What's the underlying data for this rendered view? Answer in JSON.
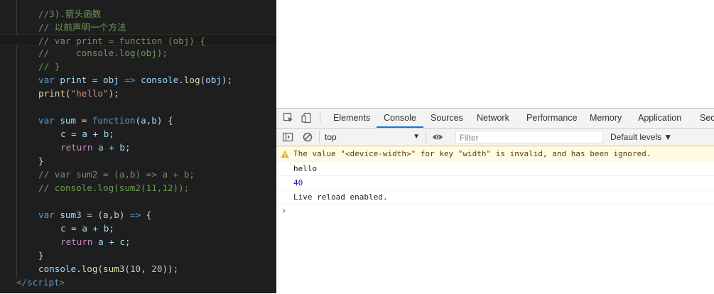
{
  "editor": {
    "lines": [
      {
        "indent": 1,
        "tokens": [
          [
            "cmt",
            "//3).箭头函数"
          ]
        ]
      },
      {
        "indent": 1,
        "tokens": [
          [
            "cmt",
            "// 以前声明一个方法"
          ]
        ]
      },
      {
        "indent": 1,
        "sel": true,
        "tokens": [
          [
            "cmt",
            "// var print = function (obj) {"
          ]
        ]
      },
      {
        "indent": 1,
        "tokens": [
          [
            "cmt",
            "//     console.log(obj);"
          ]
        ]
      },
      {
        "indent": 1,
        "tokens": [
          [
            "cmt",
            "// }"
          ]
        ]
      },
      {
        "indent": 1,
        "tokens": [
          [
            "kw",
            "var "
          ],
          [
            "var",
            "print"
          ],
          [
            "pun",
            " = "
          ],
          [
            "var",
            "obj"
          ],
          [
            "kw",
            " => "
          ],
          [
            "var",
            "console"
          ],
          [
            "pun",
            "."
          ],
          [
            "fn",
            "log"
          ],
          [
            "pun",
            "("
          ],
          [
            "var",
            "obj"
          ],
          [
            "pun",
            ");"
          ]
        ]
      },
      {
        "indent": 1,
        "tokens": [
          [
            "fn",
            "print"
          ],
          [
            "pun",
            "("
          ],
          [
            "str",
            "\"hello\""
          ],
          [
            "pun",
            ");"
          ]
        ]
      },
      {
        "indent": 1,
        "tokens": []
      },
      {
        "indent": 1,
        "tokens": [
          [
            "kw",
            "var "
          ],
          [
            "var",
            "sum"
          ],
          [
            "pun",
            " = "
          ],
          [
            "kw",
            "function"
          ],
          [
            "pun",
            "("
          ],
          [
            "var",
            "a"
          ],
          [
            "pun",
            ","
          ],
          [
            "var",
            "b"
          ],
          [
            "pun",
            ") {"
          ]
        ]
      },
      {
        "indent": 2,
        "tokens": [
          [
            "var",
            "c"
          ],
          [
            "pun",
            " = "
          ],
          [
            "var",
            "a"
          ],
          [
            "pun",
            " + "
          ],
          [
            "var",
            "b"
          ],
          [
            "pun",
            ";"
          ]
        ]
      },
      {
        "indent": 2,
        "tokens": [
          [
            "ctl",
            "return "
          ],
          [
            "var",
            "a"
          ],
          [
            "pun",
            " + "
          ],
          [
            "var",
            "b"
          ],
          [
            "pun",
            ";"
          ]
        ]
      },
      {
        "indent": 1,
        "tokens": [
          [
            "pun",
            "}"
          ]
        ]
      },
      {
        "indent": 1,
        "tokens": [
          [
            "cmt",
            "// var sum2 = (a,b) => a + b;"
          ]
        ]
      },
      {
        "indent": 1,
        "tokens": [
          [
            "cmt",
            "// console.log(sum2(11,12));"
          ]
        ]
      },
      {
        "indent": 1,
        "tokens": []
      },
      {
        "indent": 1,
        "tokens": [
          [
            "kw",
            "var "
          ],
          [
            "var",
            "sum3"
          ],
          [
            "pun",
            " = ("
          ],
          [
            "var",
            "a"
          ],
          [
            "pun",
            ","
          ],
          [
            "var",
            "b"
          ],
          [
            "pun",
            ") "
          ],
          [
            "kw",
            "=>"
          ],
          [
            "pun",
            " {"
          ]
        ]
      },
      {
        "indent": 2,
        "tokens": [
          [
            "var",
            "c"
          ],
          [
            "pun",
            " = "
          ],
          [
            "var",
            "a"
          ],
          [
            "pun",
            " + "
          ],
          [
            "var",
            "b"
          ],
          [
            "pun",
            ";"
          ]
        ]
      },
      {
        "indent": 2,
        "tokens": [
          [
            "ctl",
            "return "
          ],
          [
            "var",
            "a"
          ],
          [
            "pun",
            " + "
          ],
          [
            "var",
            "c"
          ],
          [
            "pun",
            ";"
          ]
        ]
      },
      {
        "indent": 1,
        "tokens": [
          [
            "pun",
            "}"
          ]
        ]
      },
      {
        "indent": 1,
        "tokens": [
          [
            "var",
            "console"
          ],
          [
            "pun",
            "."
          ],
          [
            "fn",
            "log"
          ],
          [
            "pun",
            "("
          ],
          [
            "fn",
            "sum3"
          ],
          [
            "pun",
            "("
          ],
          [
            "num",
            "10"
          ],
          [
            "pun",
            ", "
          ],
          [
            "num",
            "20"
          ],
          [
            "pun",
            "));"
          ]
        ]
      },
      {
        "indent": 0,
        "tokens": [
          [
            "tag",
            "</"
          ],
          [
            "tagn",
            "script"
          ],
          [
            "tag",
            ">"
          ]
        ]
      }
    ]
  },
  "devtools": {
    "tabs": [
      "Elements",
      "Console",
      "Sources",
      "Network",
      "Performance",
      "Memory",
      "Application",
      "Security"
    ],
    "active_tab": "Console",
    "context": "top",
    "filter_placeholder": "Filter",
    "levels": "Default levels ▼",
    "messages": [
      {
        "type": "warning",
        "text": "The value \"<device-width>\" for key \"width\" is invalid, and has been ignored."
      },
      {
        "type": "log",
        "text": "hello"
      },
      {
        "type": "number",
        "text": "40"
      },
      {
        "type": "log",
        "text": "Live reload enabled."
      }
    ],
    "prompt": "›"
  },
  "colors": {
    "editor_bg": "#1e1e1e",
    "comment": "#6a9955",
    "keyword": "#569cd6",
    "function": "#dcdcaa",
    "variable": "#9cdcfe",
    "string": "#ce9178",
    "number": "#b5cea8",
    "control": "#c586c0",
    "active_tab_underline": "#1a73e8",
    "warning_bg": "#fffbe5"
  }
}
